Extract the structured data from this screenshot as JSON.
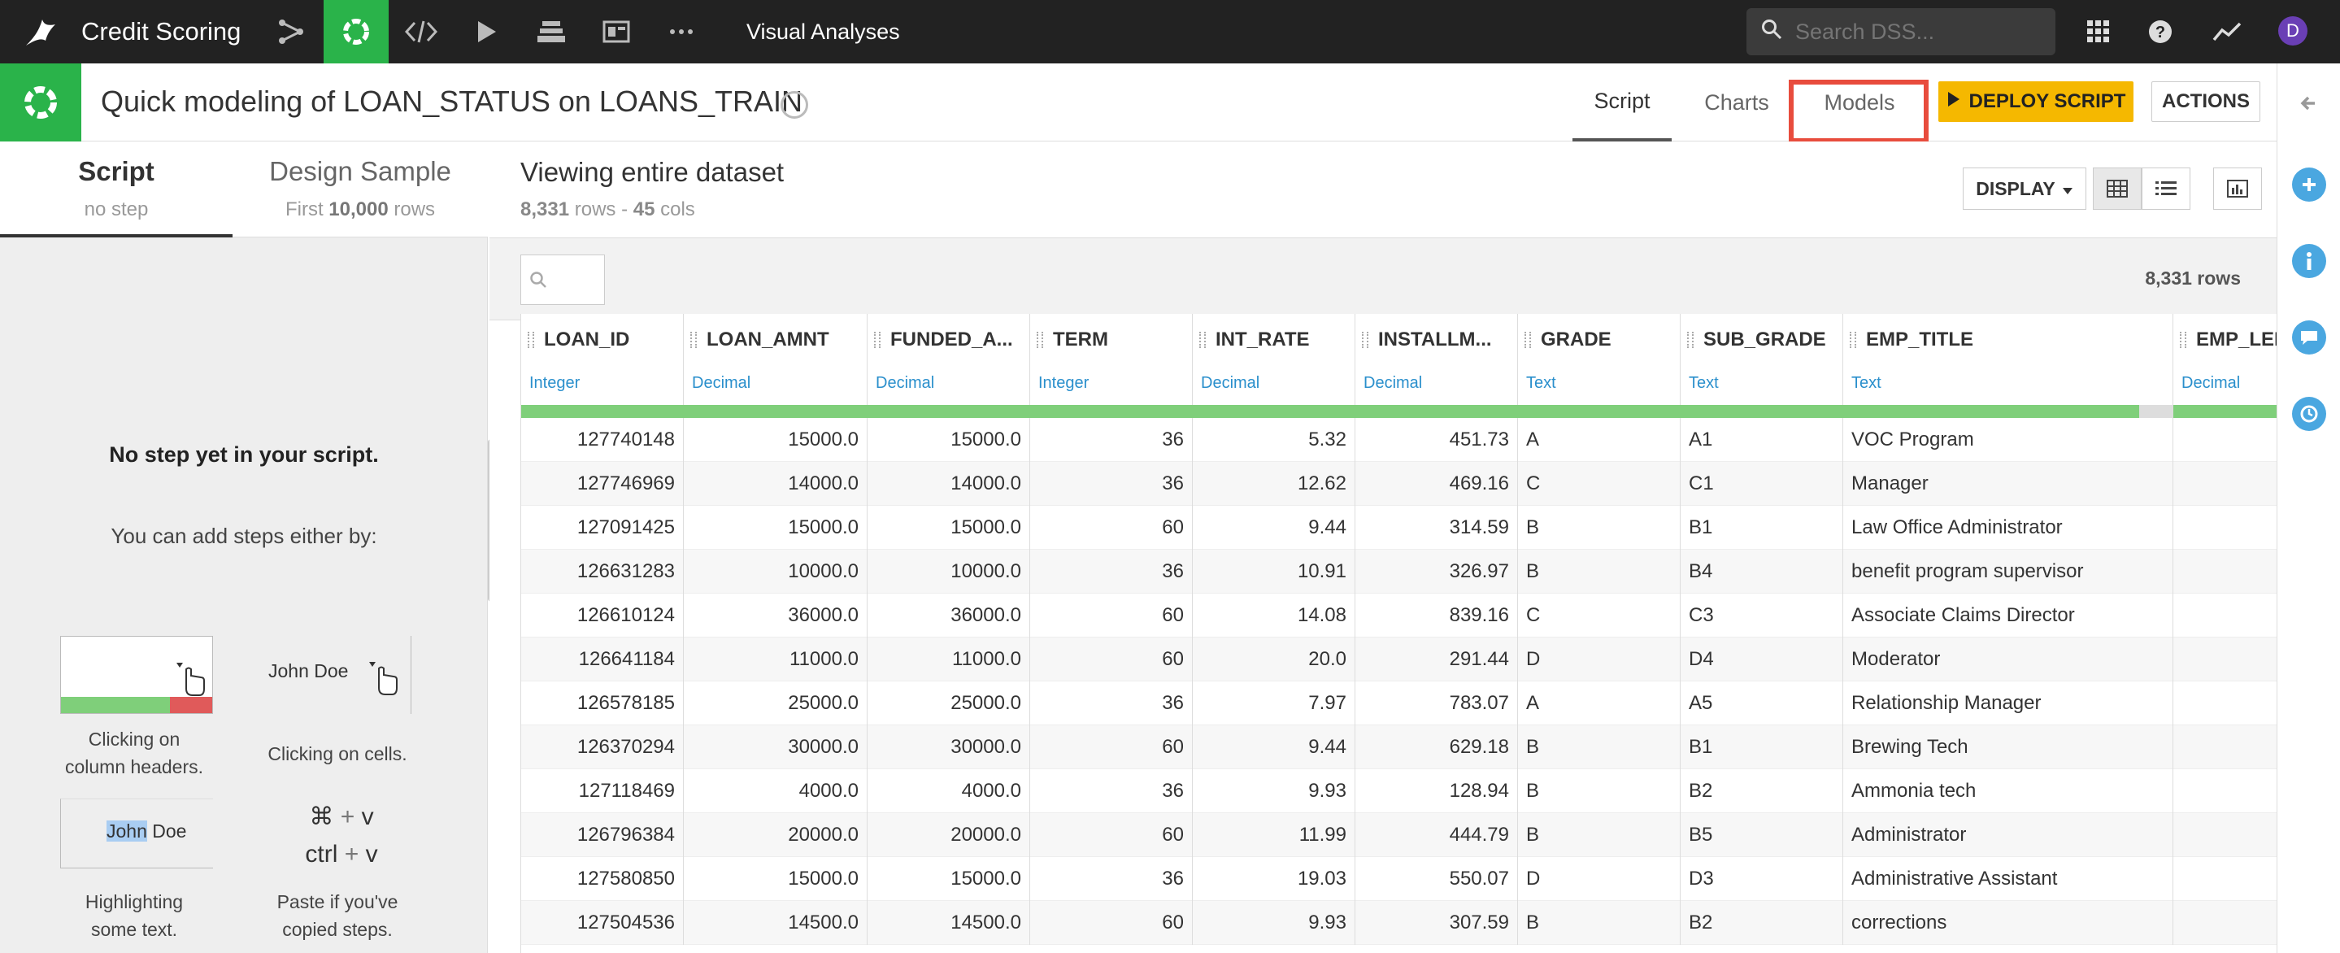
{
  "topbar": {
    "project": "Credit Scoring",
    "section": "Visual Analyses",
    "search_placeholder": "Search DSS...",
    "avatar": "D",
    "nav_icons": [
      "flow-icon",
      "analysis-icon",
      "code-icon",
      "run-icon",
      "datasets-icon",
      "dashboard-icon",
      "more-icon"
    ]
  },
  "header": {
    "title": "Quick modeling of LOAN_STATUS on LOANS_TRAIN",
    "tabs": [
      "Script",
      "Charts",
      "Models"
    ],
    "active_tab": "Script",
    "deploy": "DEPLOY SCRIPT",
    "actions": "ACTIONS"
  },
  "left": {
    "tabs": [
      {
        "label": "Script",
        "sub": "no step"
      },
      {
        "label": "Design Sample",
        "sub_pre": "First ",
        "sub_bold": "10,000",
        "sub_post": " rows"
      }
    ],
    "empty_title": "No step yet in your script.",
    "empty_sub": "You can add steps either by:",
    "hint_cell_name": "John Doe",
    "hint_highlight_a": "John",
    "hint_highlight_b": " Doe",
    "cap_headers": [
      "Clicking on",
      "column headers."
    ],
    "cap_cells": "Clicking on cells.",
    "cap_highlight": [
      "Highlighting",
      "some text."
    ],
    "cap_paste": [
      "Paste if you've",
      "copied steps."
    ],
    "key_cmd": "⌘",
    "key_ctrl": "ctrl",
    "key_plus": "+",
    "key_v": "v"
  },
  "main": {
    "view_title": "Viewing entire dataset",
    "rows": "8,331",
    "rows_label": " rows - ",
    "cols": "45",
    "cols_label": " cols",
    "display": "DISPLAY",
    "row_count": "8,331 rows"
  },
  "table": {
    "columns": [
      {
        "name": "LOAN_ID",
        "type": "Integer"
      },
      {
        "name": "LOAN_AMNT",
        "type": "Decimal"
      },
      {
        "name": "FUNDED_A...",
        "type": "Decimal"
      },
      {
        "name": "TERM",
        "type": "Integer"
      },
      {
        "name": "INT_RATE",
        "type": "Decimal"
      },
      {
        "name": "INSTALLM...",
        "type": "Decimal"
      },
      {
        "name": "GRADE",
        "type": "Text"
      },
      {
        "name": "SUB_GRADE",
        "type": "Text"
      },
      {
        "name": "EMP_TITLE",
        "type": "Text"
      },
      {
        "name": "EMP_LEI",
        "type": "Decimal"
      }
    ],
    "rows": [
      [
        "127740148",
        "15000.0",
        "15000.0",
        "36",
        "5.32",
        "451.73",
        "A",
        "A1",
        "VOC Program",
        ""
      ],
      [
        "127746969",
        "14000.0",
        "14000.0",
        "36",
        "12.62",
        "469.16",
        "C",
        "C1",
        "Manager",
        ""
      ],
      [
        "127091425",
        "15000.0",
        "15000.0",
        "60",
        "9.44",
        "314.59",
        "B",
        "B1",
        "Law Office Administrator",
        ""
      ],
      [
        "126631283",
        "10000.0",
        "10000.0",
        "36",
        "10.91",
        "326.97",
        "B",
        "B4",
        "benefit program supervisor",
        ""
      ],
      [
        "126610124",
        "36000.0",
        "36000.0",
        "60",
        "14.08",
        "839.16",
        "C",
        "C3",
        "Associate Claims Director",
        ""
      ],
      [
        "126641184",
        "11000.0",
        "11000.0",
        "60",
        "20.0",
        "291.44",
        "D",
        "D4",
        "Moderator",
        ""
      ],
      [
        "126578185",
        "25000.0",
        "25000.0",
        "36",
        "7.97",
        "783.07",
        "A",
        "A5",
        "Relationship Manager",
        ""
      ],
      [
        "126370294",
        "30000.0",
        "30000.0",
        "60",
        "9.44",
        "629.18",
        "B",
        "B1",
        "Brewing Tech",
        ""
      ],
      [
        "127118469",
        "4000.0",
        "4000.0",
        "36",
        "9.93",
        "128.94",
        "B",
        "B2",
        "Ammonia tech",
        ""
      ],
      [
        "126796384",
        "20000.0",
        "20000.0",
        "60",
        "11.99",
        "444.79",
        "B",
        "B5",
        "Administrator",
        ""
      ],
      [
        "127580850",
        "15000.0",
        "15000.0",
        "36",
        "19.03",
        "550.07",
        "D",
        "D3",
        "Administrative Assistant",
        ""
      ],
      [
        "127504536",
        "14500.0",
        "14500.0",
        "60",
        "9.93",
        "307.59",
        "B",
        "B2",
        "corrections",
        ""
      ]
    ]
  },
  "colors": {
    "accent": "#2ab34a",
    "deploy": "#f5b800",
    "highlight_box": "#e84c3d",
    "type_text": "#2a8fcc",
    "rail_icons": "#4aa7e0"
  }
}
